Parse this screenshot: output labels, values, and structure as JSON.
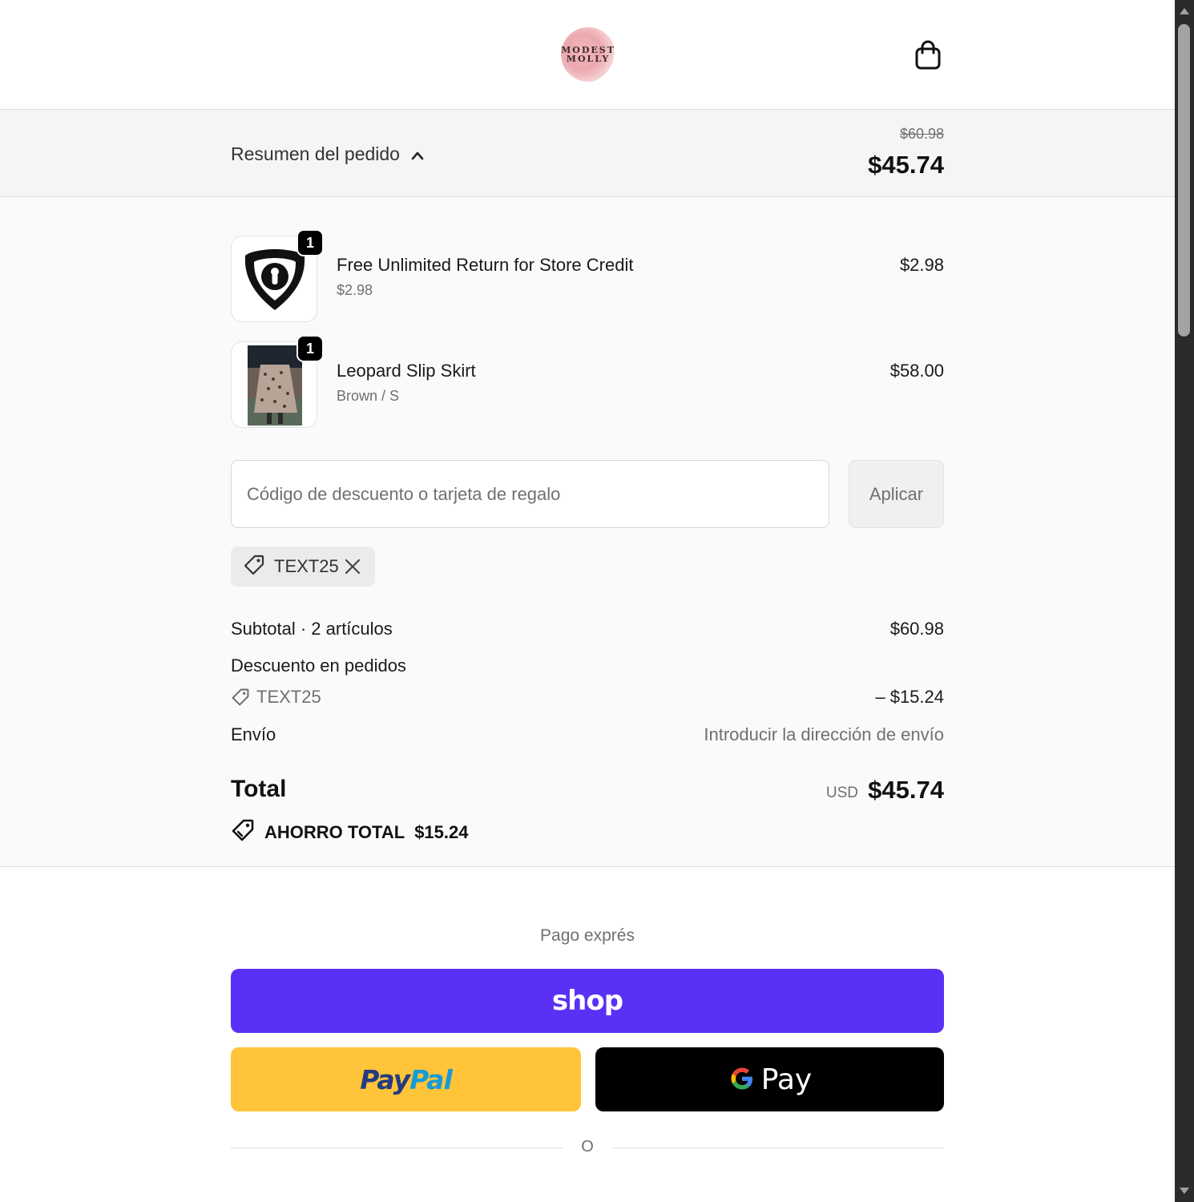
{
  "brand": {
    "logo_line1": "MODEST",
    "logo_line2": "MOLLY"
  },
  "summary_bar": {
    "toggle_label": "Resumen del pedido",
    "original_total": "$60.98",
    "total": "$45.74"
  },
  "items": [
    {
      "quantity": "1",
      "name": "Free Unlimited Return for Store Credit",
      "subtitle": "$2.98",
      "price": "$2.98",
      "icon": "shield-keyhole-icon"
    },
    {
      "quantity": "1",
      "name": "Leopard Slip Skirt",
      "subtitle": "Brown / S",
      "price": "$58.00",
      "icon": "product-photo"
    }
  ],
  "discount": {
    "placeholder": "Código de descuento o tarjeta de regalo",
    "value": "",
    "apply_label": "Aplicar",
    "applied_code": "TEXT25"
  },
  "totals": {
    "subtotal_label": "Subtotal · 2 artículos",
    "subtotal_value": "$60.98",
    "discount_label": "Descuento en pedidos",
    "discount_code": "TEXT25",
    "discount_value": "– $15.24",
    "shipping_label": "Envío",
    "shipping_value": "Introducir la dirección de envío",
    "total_label": "Total",
    "currency": "USD",
    "total_value": "$45.74",
    "savings_label": "AHORRO TOTAL",
    "savings_value": "$15.24"
  },
  "express": {
    "title": "Pago exprés",
    "shop_label": "shop",
    "paypal_part1": "Pay",
    "paypal_part2": "Pal",
    "gpay_label": "Pay",
    "or_label": "O"
  },
  "colors": {
    "shop_purple": "#5a31f4",
    "paypal_yellow": "#ffc439",
    "paypal_dark_blue": "#253b80",
    "paypal_light_blue": "#179bd7",
    "gpay_black": "#000000"
  }
}
